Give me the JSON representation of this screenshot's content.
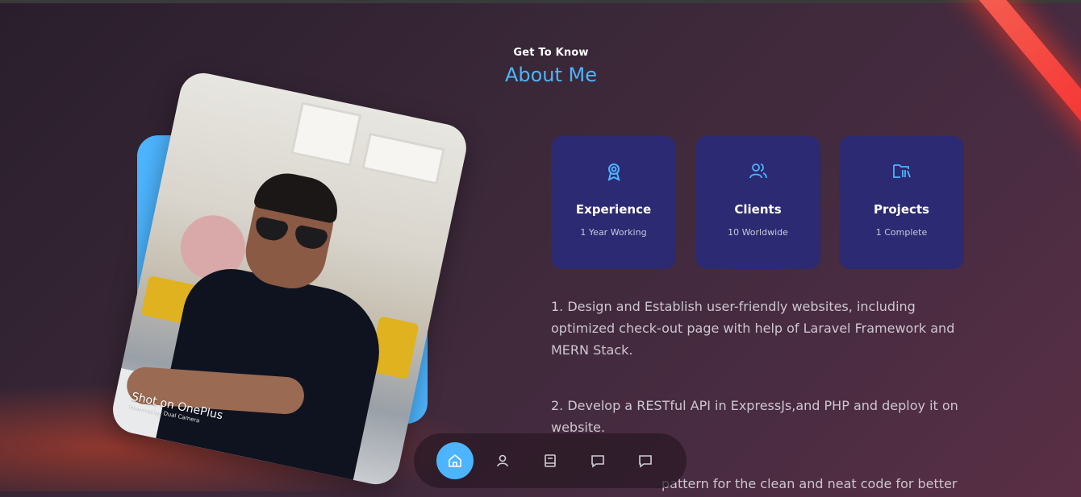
{
  "header": {
    "subtitle": "Get To Know",
    "title": "About Me"
  },
  "photo": {
    "watermark_main": "Shot on OnePlus",
    "watermark_sub": "Powered by Dual Camera"
  },
  "stats": [
    {
      "icon": "award-icon",
      "label": "Experience",
      "value": "1 Year Working"
    },
    {
      "icon": "users-icon",
      "label": "Clients",
      "value": "10 Worldwide"
    },
    {
      "icon": "projects-folder-icon",
      "label": "Projects",
      "value": "1 Complete"
    }
  ],
  "about": {
    "p1": "1. Design and Establish user-friendly websites, including optimized check-out page with help of Laravel Framework and MERN Stack.",
    "p2": "2. Develop a RESTful API in ExpressJs,and PHP and deploy it on website.",
    "p3": "pattern for the clean and neat code for better"
  },
  "nav": [
    {
      "icon": "home-icon",
      "active": true
    },
    {
      "icon": "user-icon",
      "active": false
    },
    {
      "icon": "book-icon",
      "active": false
    },
    {
      "icon": "message-icon",
      "active": false
    },
    {
      "icon": "chat-icon",
      "active": false
    }
  ],
  "colors": {
    "accent": "#4db5ff",
    "card": "#2b2a72",
    "text_muted": "#cdc6cf"
  }
}
